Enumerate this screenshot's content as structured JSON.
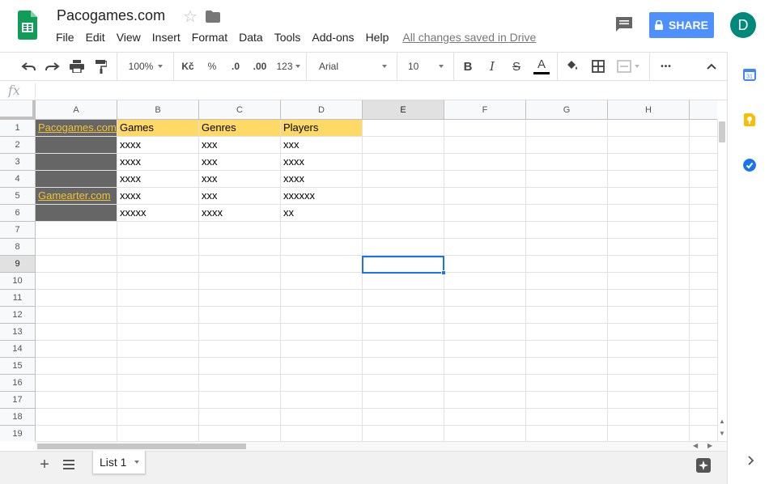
{
  "app": {
    "title": "Pacogames.com",
    "saved_status": "All changes saved in Drive",
    "share_label": "SHARE",
    "avatar_letter": "D"
  },
  "menu": [
    "File",
    "Edit",
    "View",
    "Insert",
    "Format",
    "Data",
    "Tools",
    "Add-ons",
    "Help"
  ],
  "toolbar": {
    "zoom": "100%",
    "currency": "Kč",
    "percent": "%",
    "dec_less": ".0",
    "dec_more": ".00",
    "format_more": "123",
    "font": "Arial",
    "font_size": "10",
    "bold": "B",
    "italic": "I",
    "strike": "S",
    "text_color_letter": "A",
    "more": "•••"
  },
  "formula_bar": {
    "label": "fx",
    "value": ""
  },
  "columns": [
    "A",
    "B",
    "C",
    "D",
    "E",
    "F",
    "G",
    "H"
  ],
  "rows": [
    "1",
    "2",
    "3",
    "4",
    "5",
    "6",
    "7",
    "8",
    "9",
    "10",
    "11",
    "12",
    "13",
    "14",
    "15",
    "16",
    "17",
    "18",
    "19"
  ],
  "cells": {
    "A1": "Pacogames.com",
    "A5": "Gamearter.com",
    "B1": "Games",
    "C1": "Genres",
    "D1": "Players",
    "B2": "xxxx",
    "C2": "xxx",
    "D2": "xxx",
    "B3": "xxxx",
    "C3": "xxx",
    "D3": "xxxx",
    "B4": "xxxx",
    "C4": "xxx",
    "D4": "xxxx",
    "B5": "xxxx",
    "C5": "xxx",
    "D5": "xxxxxx",
    "B6": "xxxxx",
    "C6": "xxxx",
    "D6": "xx"
  },
  "selection": {
    "cell": "E9"
  },
  "sheets": [
    {
      "name": "List 1",
      "active": true
    }
  ],
  "colors": {
    "header_fill": "#ffd966",
    "dark_fill": "#666666",
    "link": "#f1c232",
    "share_button": "#4d90fe",
    "avatar": "#00897b",
    "selection": "#1a73e8"
  },
  "icons": [
    "sheets-logo-icon",
    "star-icon",
    "folder-icon",
    "comments-icon",
    "lock-icon",
    "undo-icon",
    "redo-icon",
    "print-icon",
    "paint-format-icon",
    "fill-color-icon",
    "borders-icon",
    "merge-cells-icon",
    "collapse-icon",
    "add-sheet-icon",
    "all-sheets-icon",
    "explore-icon",
    "calendar-icon",
    "keep-icon",
    "tasks-icon",
    "expand-panel-icon"
  ]
}
